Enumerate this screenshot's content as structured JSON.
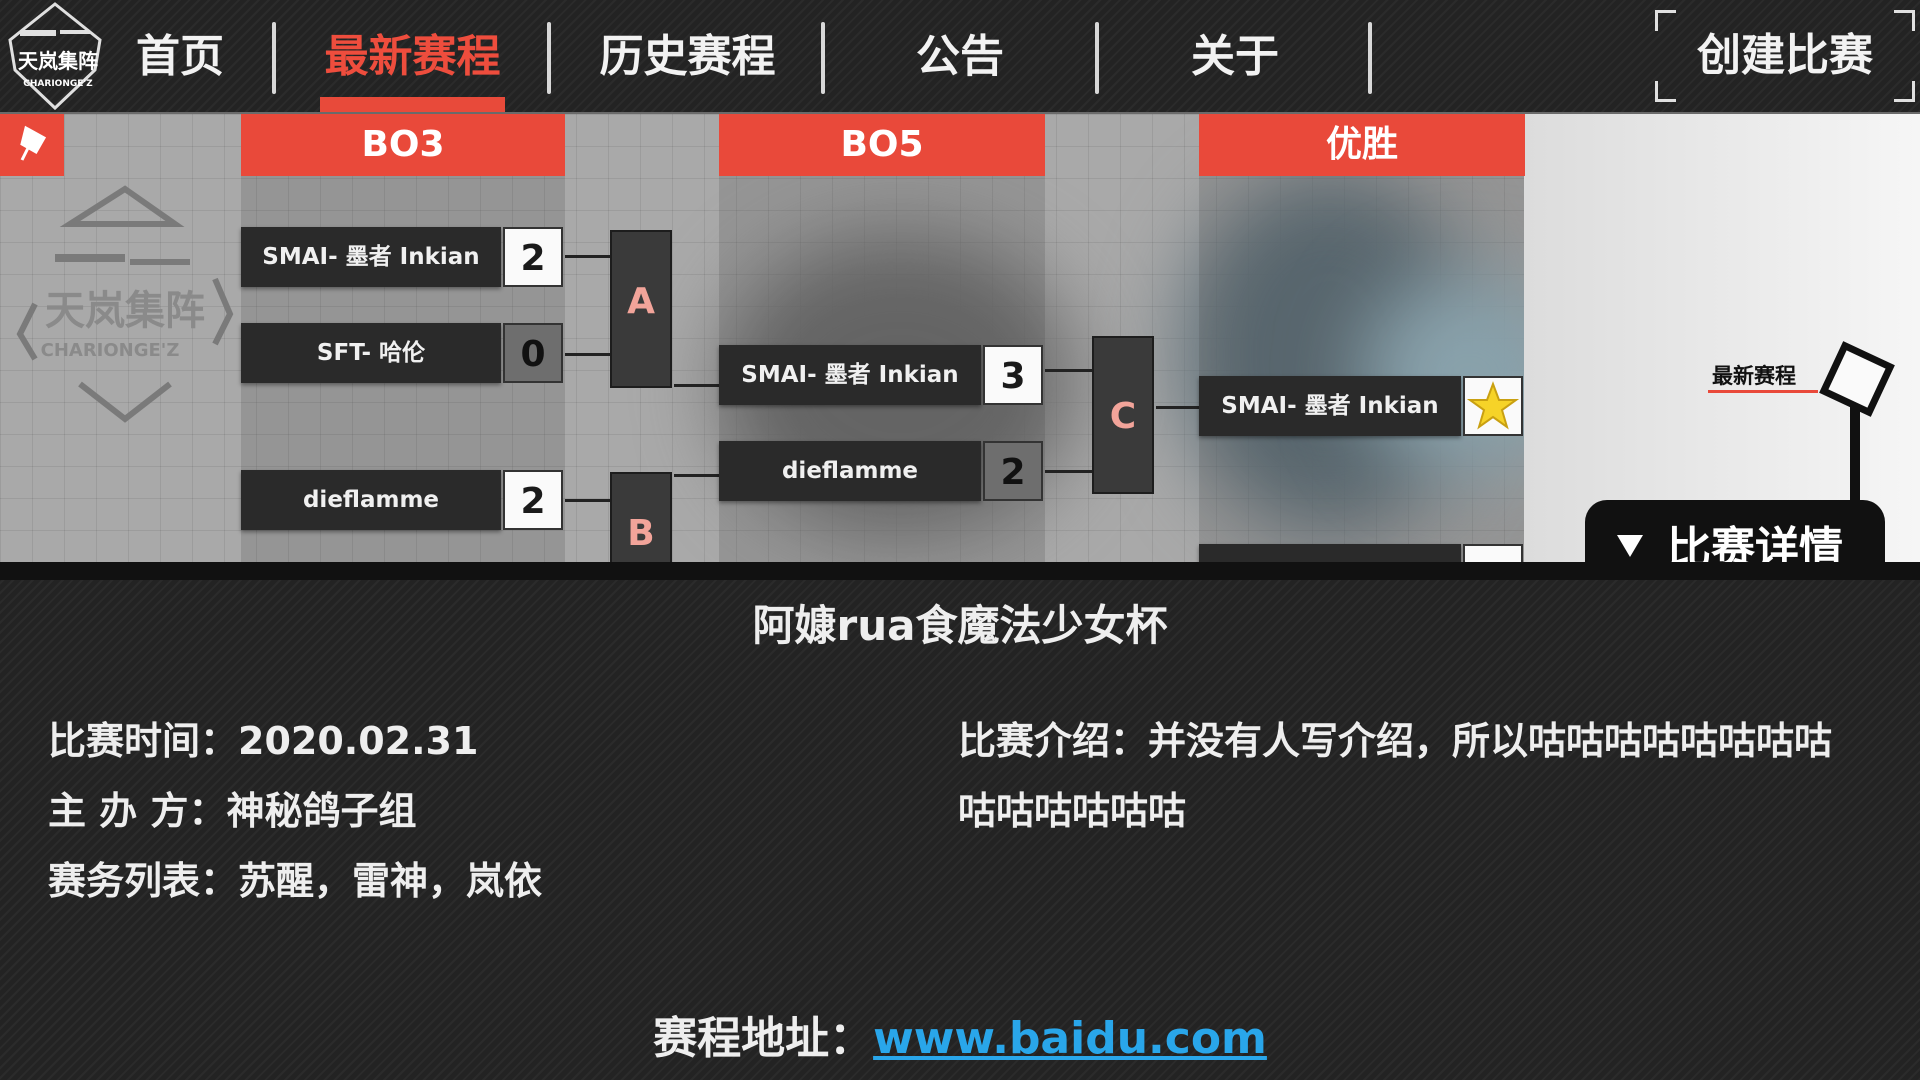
{
  "nav": {
    "logo_text": "天岚集阵",
    "logo_sub": "CHARIONGE'Z",
    "items": [
      {
        "label": "首页",
        "active": false
      },
      {
        "label": "最新赛程",
        "active": true
      },
      {
        "label": "历史赛程",
        "active": false
      },
      {
        "label": "公告",
        "active": false
      },
      {
        "label": "关于",
        "active": false
      }
    ],
    "create_label": "创建比赛"
  },
  "bracket": {
    "columns": [
      "BO3",
      "BO5",
      "优胜"
    ],
    "round1": [
      {
        "name": "SMAI- 墨者 Inkian",
        "score": "2",
        "win": true
      },
      {
        "name": "SFT- 哈伦",
        "score": "0",
        "win": false
      },
      {
        "name": "dieflamme",
        "score": "2",
        "win": true
      }
    ],
    "round2": [
      {
        "name": "SMAI- 墨者 Inkian",
        "score": "3",
        "win": true
      },
      {
        "name": "dieflamme",
        "score": "2",
        "win": false
      }
    ],
    "winner": {
      "name": "SMAI- 墨者 Inkian"
    },
    "match_labels": [
      "A",
      "B",
      "C"
    ],
    "side_label": "最新赛程",
    "detail_tab": "比赛详情",
    "accent": "#e9493a"
  },
  "info": {
    "title": "阿嫝rua食魔法少女杯",
    "time": "比赛时间：2020.02.31",
    "organizer": "主 办 方：神秘鸽子组",
    "staff": "赛务列表：苏醒，雷神，岚依",
    "intro_line1": "比赛介绍：并没有人写介绍，所以咕咕咕咕咕咕咕咕",
    "intro_line2": "咕咕咕咕咕咕",
    "address_label": "赛程地址：",
    "address_url": "www.baidu.com",
    "link_color": "#29a6ea"
  }
}
